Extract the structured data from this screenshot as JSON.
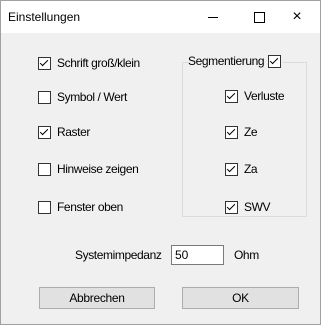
{
  "window": {
    "title": "Einstellungen",
    "close_glyph": "×"
  },
  "options": [
    {
      "label": "Schrift groß/klein",
      "checked": true
    },
    {
      "label": "Symbol / Wert",
      "checked": false
    },
    {
      "label": "Raster",
      "checked": true
    },
    {
      "label": "Hinweise zeigen",
      "checked": false
    },
    {
      "label": "Fenster oben",
      "checked": false
    }
  ],
  "segment_group": {
    "label": "Segmentierung",
    "checked": true,
    "items": [
      {
        "label": "Verluste",
        "checked": true
      },
      {
        "label": "Ze",
        "checked": true
      },
      {
        "label": "Za",
        "checked": true
      },
      {
        "label": "SWV",
        "checked": true
      }
    ]
  },
  "impedance": {
    "label": "Systemimpedanz",
    "value": "50",
    "unit": "Ohm"
  },
  "buttons": {
    "cancel": "Abbrechen",
    "ok": "OK"
  }
}
